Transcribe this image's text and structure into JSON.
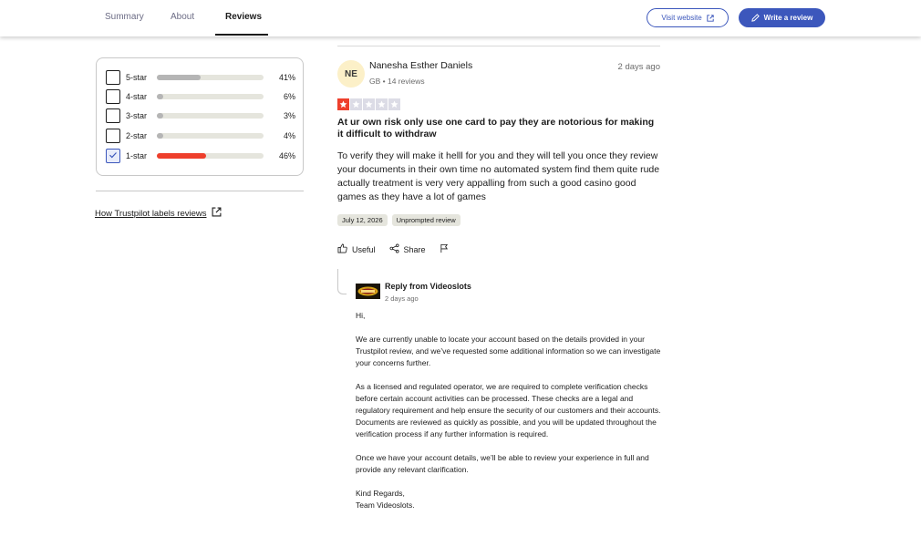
{
  "nav": {
    "tabs": [
      {
        "label": "Summary",
        "active": false
      },
      {
        "label": "About",
        "active": false
      },
      {
        "label": "Reviews",
        "active": true
      }
    ],
    "visit_website": "Visit website",
    "write_review": "Write a review"
  },
  "filters": {
    "rows": [
      {
        "label": "5-star",
        "percent": "41%",
        "fill": 0.41,
        "checked": false
      },
      {
        "label": "4-star",
        "percent": "6%",
        "fill": 0.06,
        "checked": false
      },
      {
        "label": "3-star",
        "percent": "3%",
        "fill": 0.03,
        "checked": false
      },
      {
        "label": "2-star",
        "percent": "4%",
        "fill": 0.04,
        "checked": false
      },
      {
        "label": "1-star",
        "percent": "46%",
        "fill": 0.46,
        "checked": true
      }
    ],
    "how_link": "How Trustpilot labels reviews"
  },
  "review": {
    "avatar_initials": "NE",
    "name": "Nanesha Esther Daniels",
    "meta": "GB • 14 reviews",
    "date": "2 days ago",
    "rating": 1,
    "title": "At ur own risk only use one card to pay they are notorious for making it difficult to withdraw",
    "body": "To verify they will make it helll for you and they will tell you once they review your documents in their own time no automated system find them quite rude actually treatment is very very appalling from such a good casino good games as they have a lot of games",
    "chips": [
      "July 12, 2026",
      "Unprompted review"
    ],
    "actions": {
      "useful": "Useful",
      "share": "Share"
    }
  },
  "reply": {
    "from": "Reply from Videoslots",
    "ago": "2 days ago",
    "paragraphs": [
      "Hi,",
      "We are currently unable to locate your account based on the details provided in your Trustpilot review, and we’ve requested some additional information so we can investigate your concerns further.",
      "As a licensed and regulated operator, we are required to complete verification checks before certain account activities can be processed. These checks are a legal and regulatory requirement and help ensure the security of our customers and their accounts. Documents are reviewed as quickly as possible, and you will be updated throughout the verification process if any further information is required.",
      "Once we have your account details, we’ll be able to review your experience in full and provide any relevant clarification.",
      "Kind Regards,\nTeam Videoslots."
    ]
  },
  "colors": {
    "accent": "#3c57bc",
    "one_star_red": "#ee3f2c",
    "bar_track": "#e5e5dd",
    "bar_fill_gray": "#b5b5b5"
  }
}
